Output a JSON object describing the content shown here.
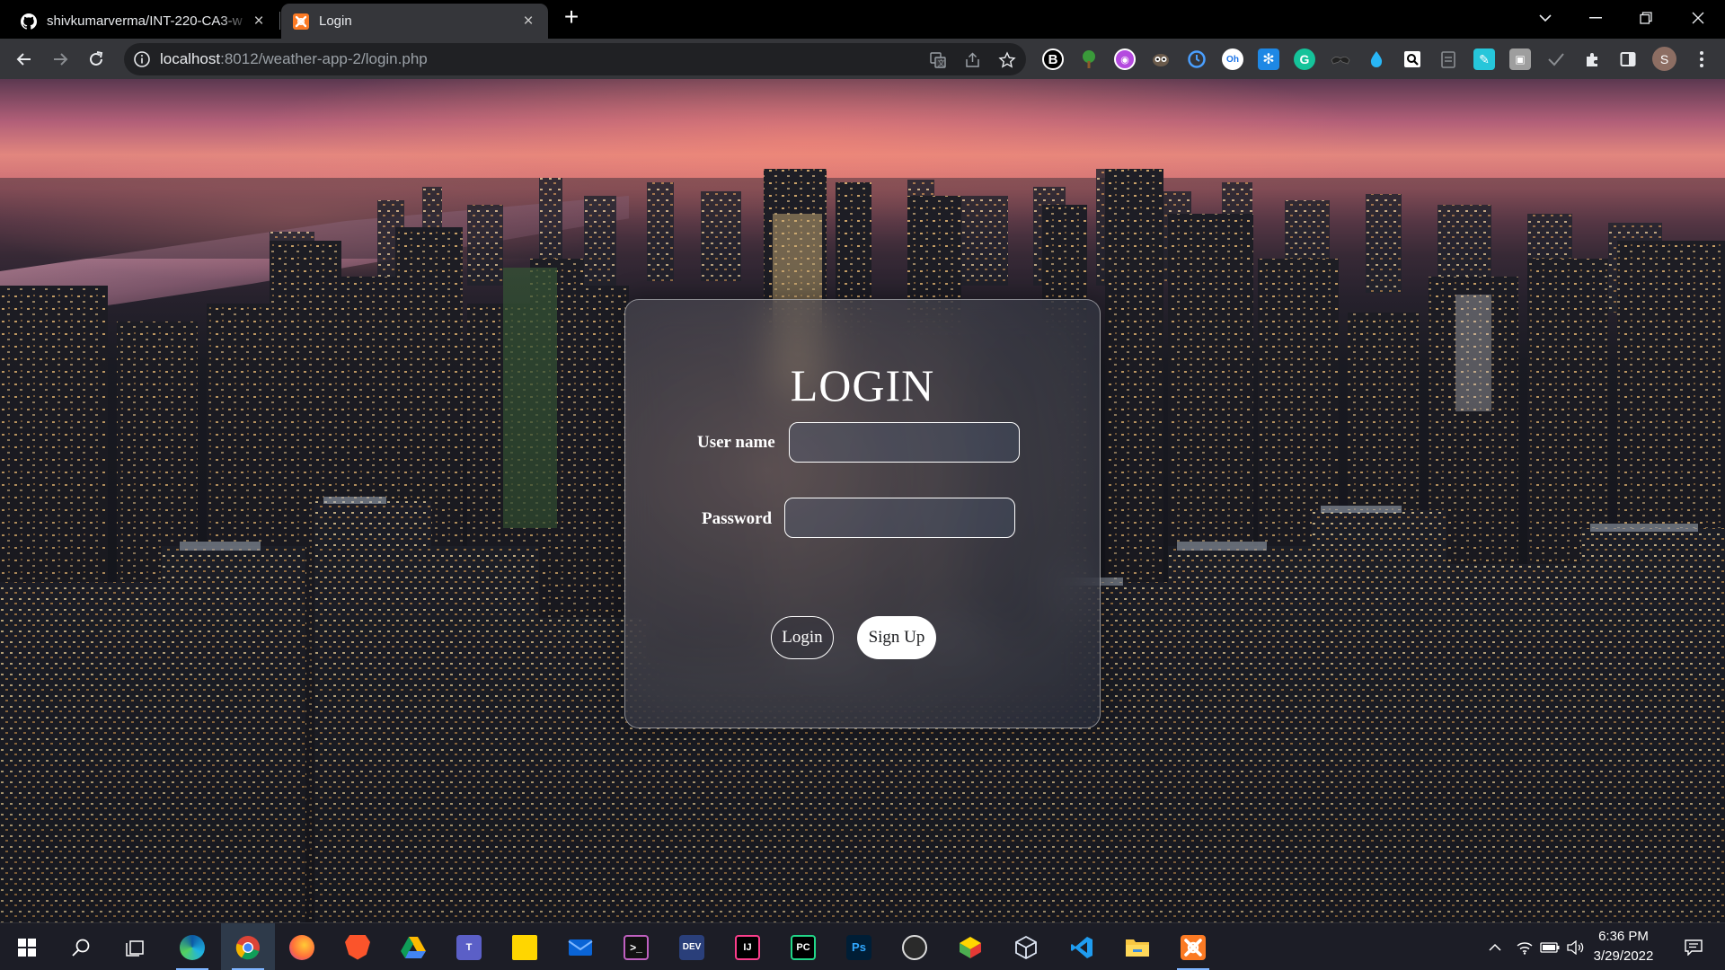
{
  "browser": {
    "tabs": [
      {
        "title": "shivkumarverma/INT-220-CA3-w",
        "icon": "github-icon",
        "active": false
      },
      {
        "title": "Login",
        "icon": "xampp-icon",
        "active": true
      }
    ],
    "url": {
      "host": "localhost",
      "rest": ":8012/weather-app-2/login.php"
    },
    "extensions": [
      "bold-b-icon",
      "tree-icon",
      "purple-circle-icon",
      "owl-icon",
      "clock-icon",
      "ai-icon",
      "snowflake-icon",
      "grammarly-icon",
      "glasses-icon",
      "drop-icon",
      "search-page-icon",
      "clipboard-icon",
      "pen-icon",
      "screenshot-icon",
      "check-icon",
      "puzzle-icon",
      "sidepanel-icon"
    ],
    "profile_initial": "S"
  },
  "login": {
    "title": "LOGIN",
    "username_label": "User name",
    "username_value": "",
    "password_label": "Password",
    "password_value": "",
    "login_button": "Login",
    "signup_button": "Sign Up"
  },
  "taskbar": {
    "apps": [
      "edge",
      "chrome",
      "firefox",
      "brave",
      "google-drive",
      "teams",
      "sticky-notes",
      "mail",
      "terminal",
      "dev",
      "intellij",
      "pycharm",
      "photoshop",
      "obs",
      "bluestacks",
      "3d-viewer",
      "vscode",
      "file-explorer",
      "xampp"
    ],
    "time": "6:36 PM",
    "date": "3/29/2022"
  }
}
